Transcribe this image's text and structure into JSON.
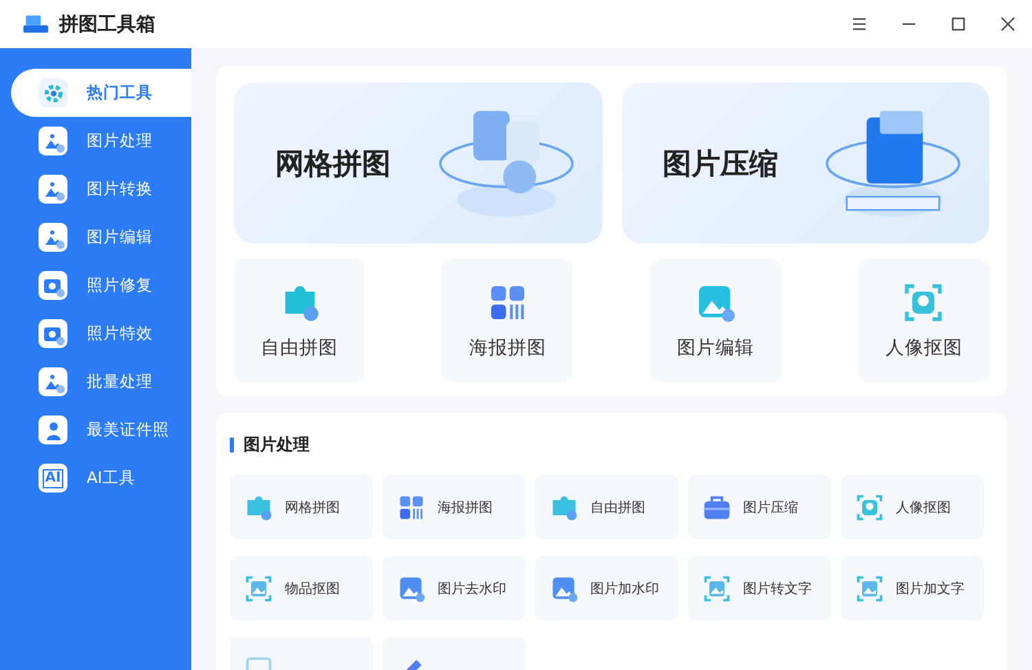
{
  "window": {
    "title": "拼图工具箱"
  },
  "sidebar": {
    "items": [
      {
        "label": "热门工具",
        "kind": "gear",
        "selected": true
      },
      {
        "label": "图片处理",
        "kind": "image",
        "selected": false
      },
      {
        "label": "图片转换",
        "kind": "image",
        "selected": false
      },
      {
        "label": "图片编辑",
        "kind": "image",
        "selected": false
      },
      {
        "label": "照片修复",
        "kind": "camera",
        "selected": false
      },
      {
        "label": "照片特效",
        "kind": "camera",
        "selected": false
      },
      {
        "label": "批量处理",
        "kind": "image",
        "selected": false
      },
      {
        "label": "最美证件照",
        "kind": "person",
        "selected": false
      },
      {
        "label": "AI工具",
        "kind": "ai",
        "icon_text": "AI",
        "selected": false
      }
    ]
  },
  "hot": {
    "banners": [
      {
        "label": "网格拼图",
        "kind": "puzzle"
      },
      {
        "label": "图片压缩",
        "kind": "folder"
      }
    ],
    "tiles": [
      {
        "label": "自由拼图",
        "kind": "puzzle"
      },
      {
        "label": "海报拼图",
        "kind": "grid"
      },
      {
        "label": "图片编辑",
        "kind": "image"
      },
      {
        "label": "人像抠图",
        "kind": "portrait"
      }
    ]
  },
  "section": {
    "title": "图片处理",
    "tools": [
      {
        "label": "网格拼图",
        "kind": "puzzle"
      },
      {
        "label": "海报拼图",
        "kind": "grid"
      },
      {
        "label": "自由拼图",
        "kind": "puzzle"
      },
      {
        "label": "图片压缩",
        "kind": "case"
      },
      {
        "label": "人像抠图",
        "kind": "portrait"
      },
      {
        "label": "物品抠图",
        "kind": "frame"
      },
      {
        "label": "图片去水印",
        "kind": "image"
      },
      {
        "label": "图片加水印",
        "kind": "image"
      },
      {
        "label": "图片转文字",
        "kind": "frame"
      },
      {
        "label": "图片加文字",
        "kind": "frame"
      }
    ],
    "partial_tools": [
      {
        "kind": "frame"
      },
      {
        "kind": "pen"
      }
    ]
  }
}
